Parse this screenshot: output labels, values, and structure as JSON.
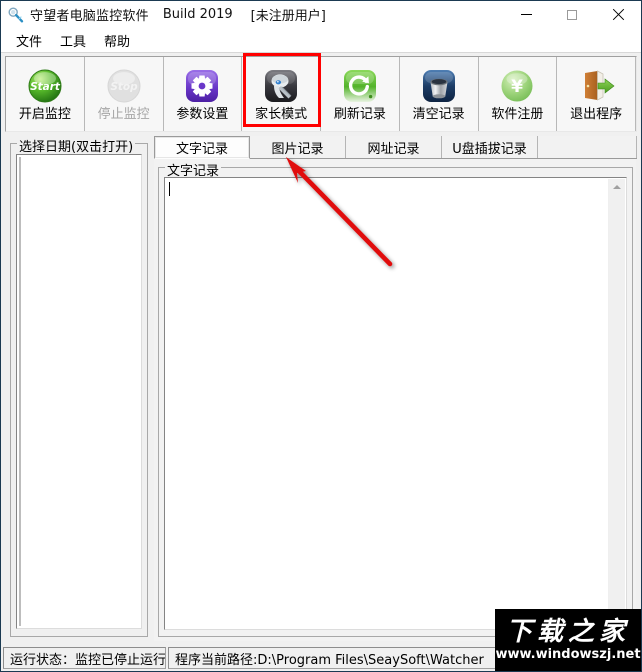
{
  "window": {
    "icon": "magnifier-tool-icon",
    "title": "守望者电脑监控软件",
    "build": "Build 2019",
    "registration": "[未注册用户]",
    "minimize_label": "—",
    "maximize_label": "□",
    "close_label": "✕"
  },
  "menubar": {
    "items": [
      {
        "label": "文件"
      },
      {
        "label": "工具"
      },
      {
        "label": "帮助"
      }
    ]
  },
  "toolbar": {
    "buttons": [
      {
        "label": "开启监控",
        "icon": "start-green-icon",
        "disabled": false
      },
      {
        "label": "停止监控",
        "icon": "stop-gray-icon",
        "disabled": true
      },
      {
        "label": "参数设置",
        "icon": "gear-purple-icon",
        "disabled": false
      },
      {
        "label": "家长模式",
        "icon": "parent-robot-icon",
        "disabled": false
      },
      {
        "label": "刷新记录",
        "icon": "refresh-green-icon",
        "disabled": false
      },
      {
        "label": "清空记录",
        "icon": "trash-bin-icon",
        "disabled": false
      },
      {
        "label": "软件注册",
        "icon": "yuan-coin-icon",
        "disabled": false
      },
      {
        "label": "退出程序",
        "icon": "exit-door-icon",
        "disabled": false
      }
    ],
    "highlight_index": 3,
    "highlight_color": "#ff0000"
  },
  "left_panel": {
    "group_title": "选择日期(双击打开)",
    "list_items": []
  },
  "tabs": [
    {
      "label": "文字记录",
      "active": true
    },
    {
      "label": "图片记录",
      "active": false
    },
    {
      "label": "网址记录",
      "active": false
    },
    {
      "label": "U盘插拔记录",
      "active": false
    }
  ],
  "content": {
    "group_title": "文字记录",
    "text_value": ""
  },
  "statusbar": {
    "run_state": "运行状态：监控已停止运行",
    "path": "程序当前路径:D:\\Program Files\\SeaySoft\\Watcher"
  },
  "annotation": {
    "arrow_color": "#e01010",
    "points_to": "图片记录"
  },
  "watermark": {
    "brand_cn": "下载之家",
    "url": "www.windowszj.net"
  }
}
